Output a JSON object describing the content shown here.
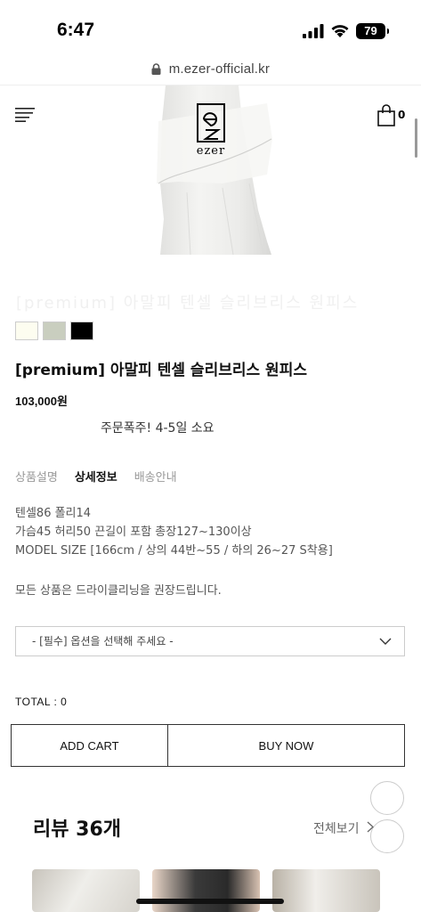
{
  "status": {
    "time": "6:47",
    "battery": "79"
  },
  "browser": {
    "url": "m.ezer-official.kr"
  },
  "header": {
    "logo_text": "ezer",
    "cart_count": "0"
  },
  "product": {
    "faded_text": "[premium] 아말피 텐셀 슬리브리스 원피스",
    "swatches": [
      "#fdfdf0",
      "#c9cebf",
      "#000000"
    ],
    "name": "[premium] 아말피 텐셀 슬리브리스 원피스",
    "price": "103,000원",
    "notice": "주문폭주! 4-5일 소요"
  },
  "tabs": [
    "상품설명",
    "상세정보",
    "배송안내"
  ],
  "details": {
    "lines": [
      "텐셀86 폴리14",
      "가슴45 허리50 끈길이 포함 총장127~130이상",
      "MODEL SIZE [166cm / 상의 44반~55 / 하의 26~27 S착용]"
    ],
    "care": "모든 상품은 드라이클리닝을 권장드립니다."
  },
  "option": {
    "placeholder": "- [필수] 옵션을 선택해 주세요 -"
  },
  "total": "TOTAL : 0",
  "buttons": {
    "add_cart": "ADD CART",
    "buy_now": "BUY NOW"
  },
  "reviews": {
    "title": "리뷰 36개",
    "more": "전체보기"
  }
}
